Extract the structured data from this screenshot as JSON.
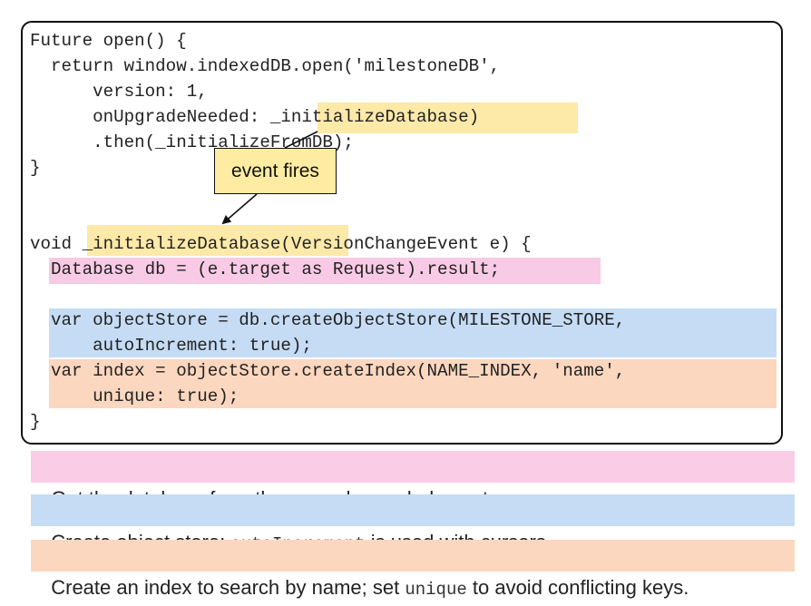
{
  "code": {
    "lines": [
      "Future open() {",
      "  return window.indexedDB.open('milestoneDB',",
      "      version: 1,",
      "      onUpgradeNeeded: _initializeDatabase)",
      "      .then(_initializeFromDB);",
      "}",
      "",
      "void _initializeDatabase(VersionChangeEvent e) {",
      "  Database db = (e.target as Request).result;",
      "",
      "  var objectStore = db.createObjectStore(MILESTONE_STORE,",
      "      autoIncrement: true);",
      "  var index = objectStore.createIndex(NAME_INDEX, 'name',",
      "      unique: true);",
      "}"
    ]
  },
  "callout": {
    "text": "event fires"
  },
  "notes": [
    {
      "color": "#fbcce6",
      "parts": [
        {
          "text": "Get the database from the upgrade needed event.",
          "code": false
        }
      ]
    },
    {
      "color": "#c5dcf4",
      "parts": [
        {
          "text": "Create object store; ",
          "code": false
        },
        {
          "text": "autoIncrement",
          "code": true
        },
        {
          "text": " is used with cursors.",
          "code": false
        }
      ]
    },
    {
      "color": "#fbd7bf",
      "parts": [
        {
          "text": "Create an index to search by name; set ",
          "code": false
        },
        {
          "text": "unique",
          "code": true
        },
        {
          "text": " to avoid conflicting keys.",
          "code": false
        }
      ]
    }
  ],
  "colors": {
    "yellow_highlight": "#fde9a8",
    "pink_highlight": "#f9cae5",
    "blue_highlight": "#c5dcf4",
    "orange_highlight": "#fbd7bf"
  }
}
